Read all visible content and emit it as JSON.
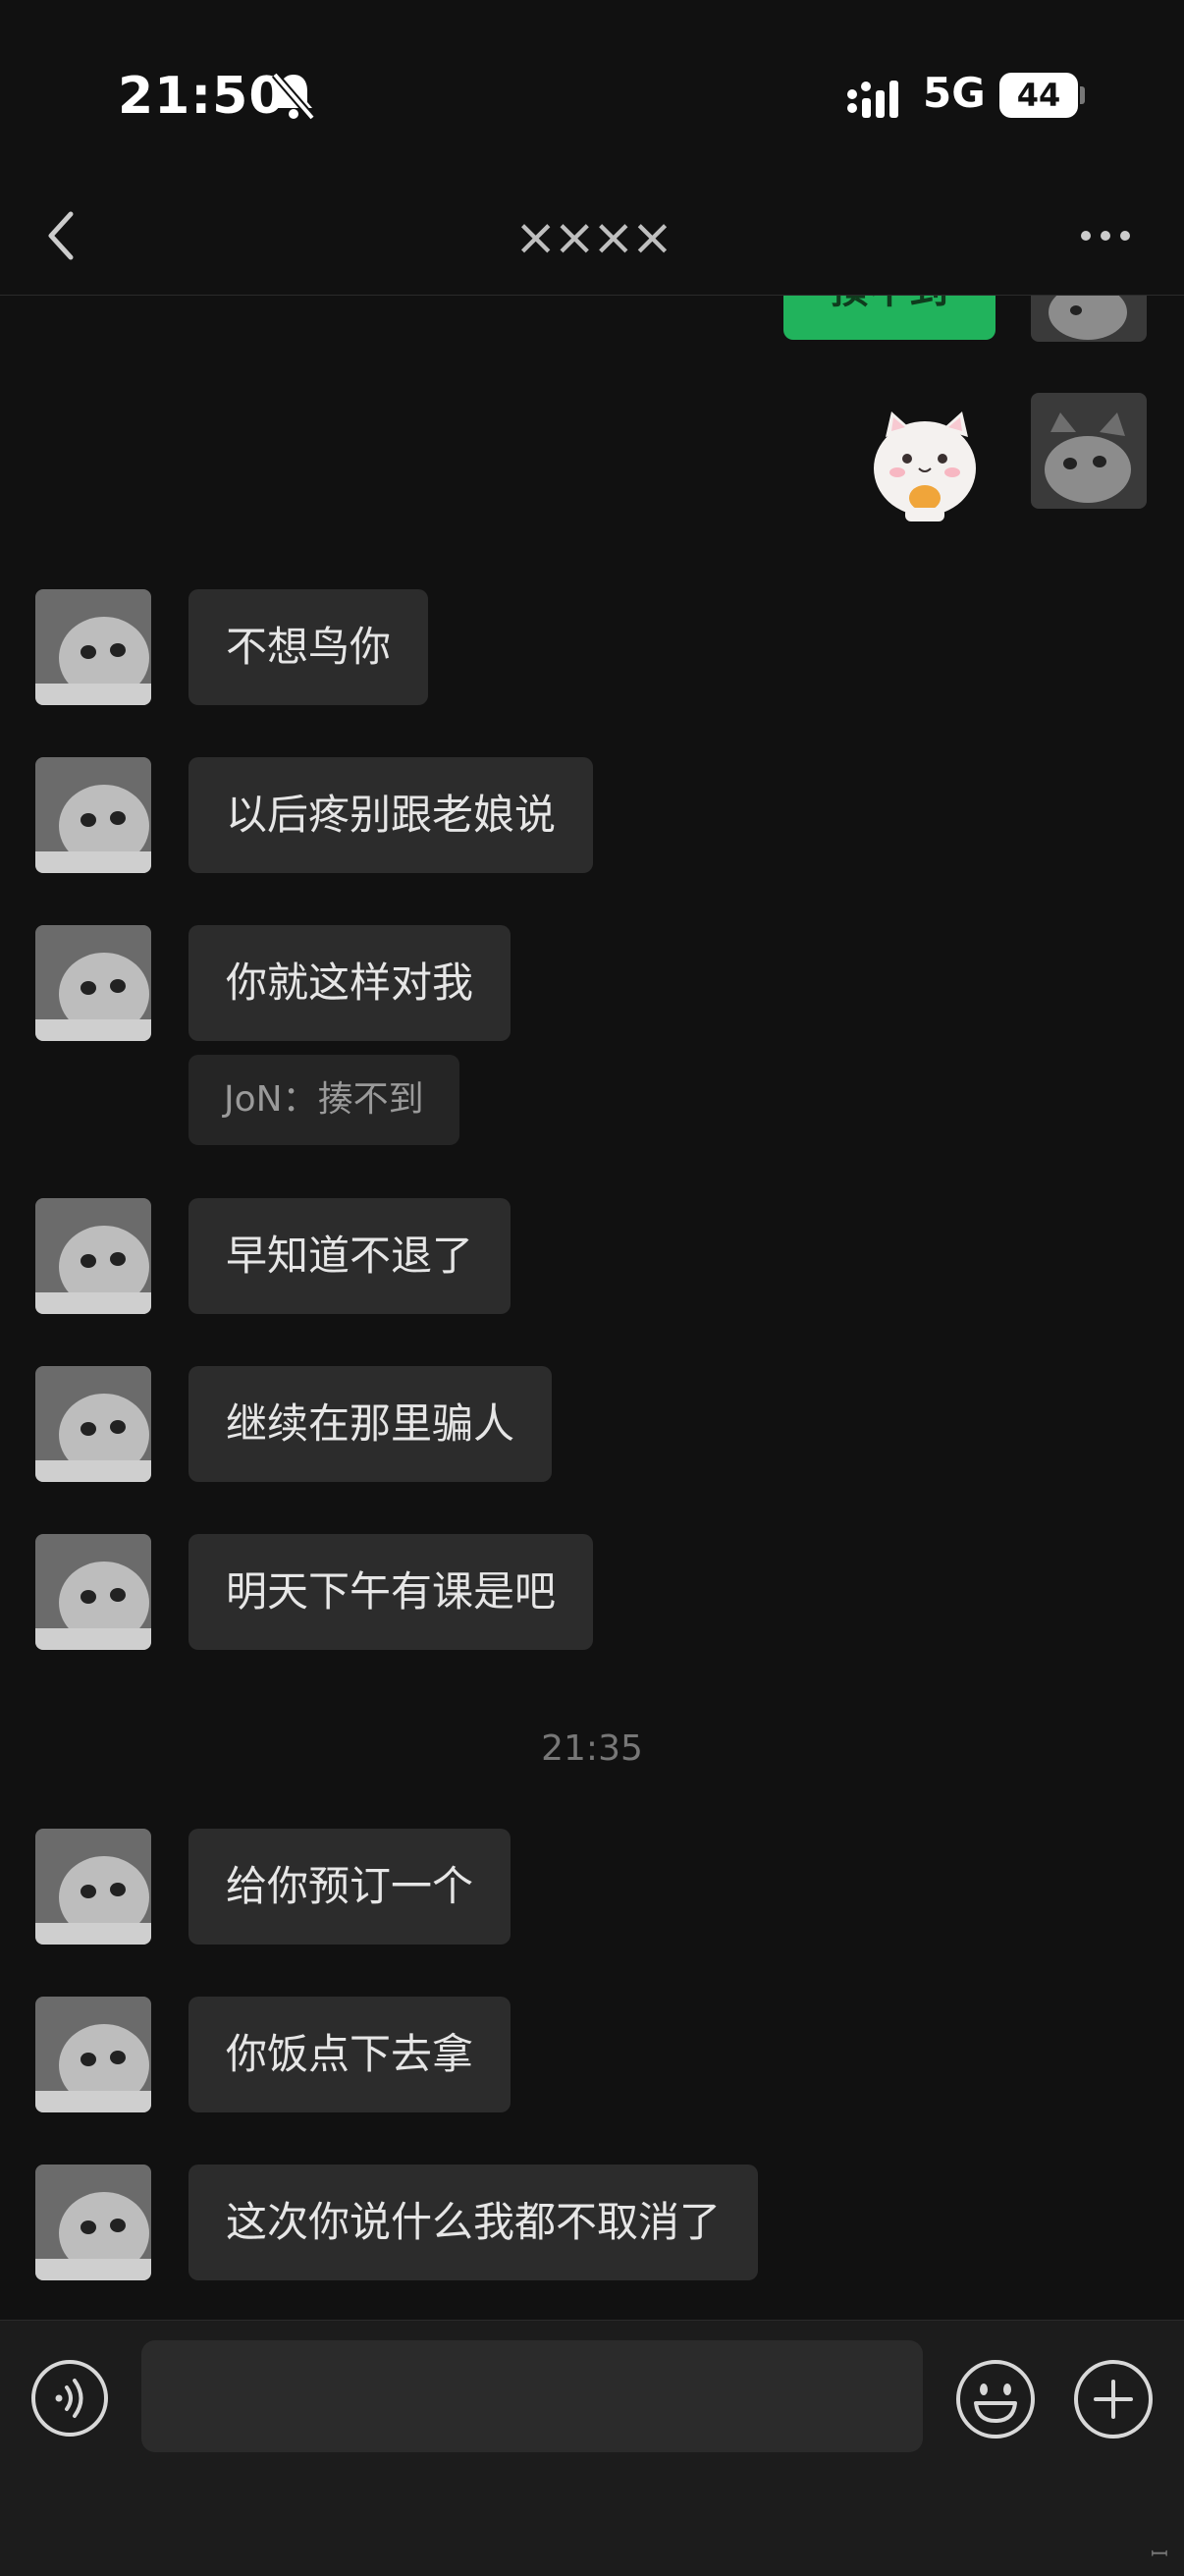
{
  "status": {
    "time": "21:50",
    "network": "5G",
    "battery": "44"
  },
  "nav": {
    "title": "××××"
  },
  "sent_partial": "揍不到",
  "messages": [
    {
      "text": "不想鸟你"
    },
    {
      "text": "以后疼别跟老娘说"
    },
    {
      "text": "你就这样对我",
      "quote": "JoN：揍不到"
    },
    {
      "text": "早知道不退了"
    },
    {
      "text": "继续在那里骗人"
    },
    {
      "text": "明天下午有课是吧"
    },
    {
      "text": "给你预订一个"
    },
    {
      "text": "你饭点下去拿"
    },
    {
      "text": "这次你说什么我都不取消了"
    }
  ],
  "timestamp": "21:35",
  "input": {
    "placeholder": ""
  },
  "colors": {
    "background": "#111111",
    "bubble": "#2c2c2c",
    "sent_bubble": "#21b35c",
    "text": "#e6e6e6"
  },
  "icons": [
    "bell-slash-icon",
    "signal-icon",
    "back-icon",
    "more-icon",
    "voice-icon",
    "emoji-icon",
    "plus-icon",
    "cat-sticker"
  ]
}
